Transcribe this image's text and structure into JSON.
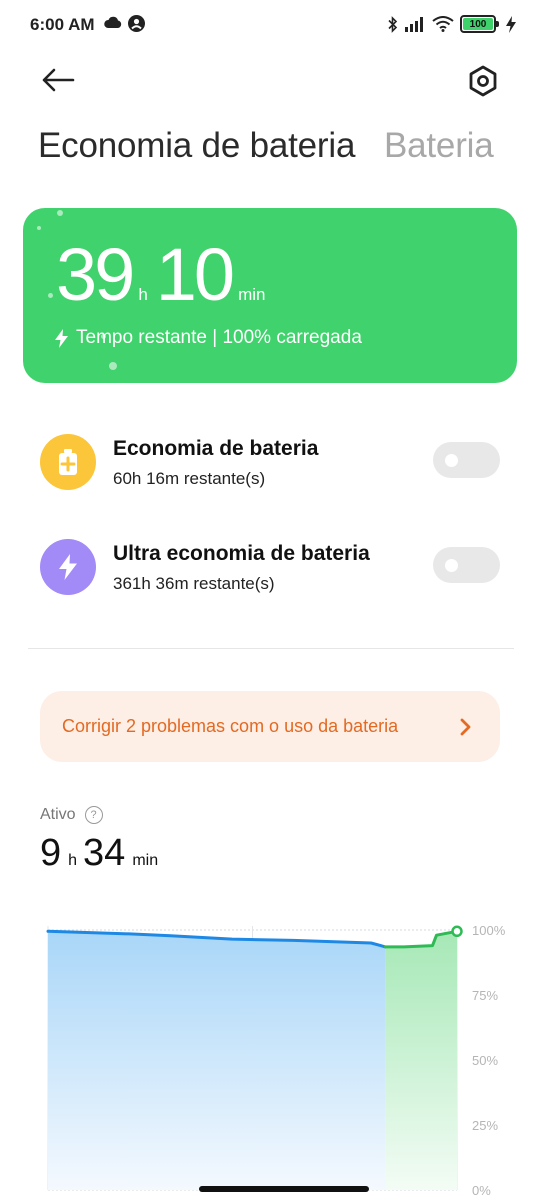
{
  "status_bar": {
    "time": "6:00 AM",
    "battery_level": "100",
    "icons": [
      "cloud-icon",
      "account-icon",
      "bluetooth-icon",
      "signal-icon",
      "wifi-icon",
      "battery-icon",
      "charging-icon"
    ]
  },
  "header": {
    "back_icon": "arrow-left-icon",
    "settings_icon": "settings-hexagon-icon"
  },
  "tabs": [
    {
      "label": "Economia de bateria",
      "active": true
    },
    {
      "label": "Bateria",
      "active": false
    }
  ],
  "hero": {
    "hours": "39",
    "hours_unit": "h",
    "minutes": "10",
    "minutes_unit": "min",
    "subtitle": "Tempo restante | 100% carregada",
    "color": "#40d26c"
  },
  "modes": [
    {
      "title": "Economia de bateria",
      "remaining": "60h 16m restante(s)",
      "icon": "battery-plus-icon",
      "icon_color": "#fcc63a",
      "enabled": false
    },
    {
      "title": "Ultra economia de bateria",
      "remaining": "361h 36m restante(s)",
      "icon": "lightning-icon",
      "icon_color": "#a28af7",
      "enabled": false
    }
  ],
  "fix_banner": {
    "label": "Corrigir 2 problemas com o uso da bateria",
    "color": "#e36a22"
  },
  "active": {
    "label": "Ativo",
    "hours": "9",
    "hours_unit": "h",
    "minutes": "34",
    "minutes_unit": "min"
  },
  "chart_data": {
    "type": "area",
    "ylim": [
      0,
      100
    ],
    "y_tick_labels": [
      "100%",
      "75%",
      "50%",
      "25%",
      "0%"
    ],
    "series": [
      {
        "segment": "discharging",
        "color": "#1e88e5",
        "x": [
          0,
          0.2,
          0.3,
          0.45,
          0.6,
          0.7,
          0.79,
          0.825
        ],
        "y": [
          99.5,
          98.5,
          97.8,
          96.5,
          96.0,
          95.5,
          95.0,
          93.5
        ]
      },
      {
        "segment": "charging",
        "color": "#2ebb55",
        "x": [
          0.825,
          0.87,
          0.94,
          0.95,
          1.0
        ],
        "y": [
          93.5,
          93.5,
          94.0,
          98.0,
          99.5
        ]
      }
    ]
  }
}
